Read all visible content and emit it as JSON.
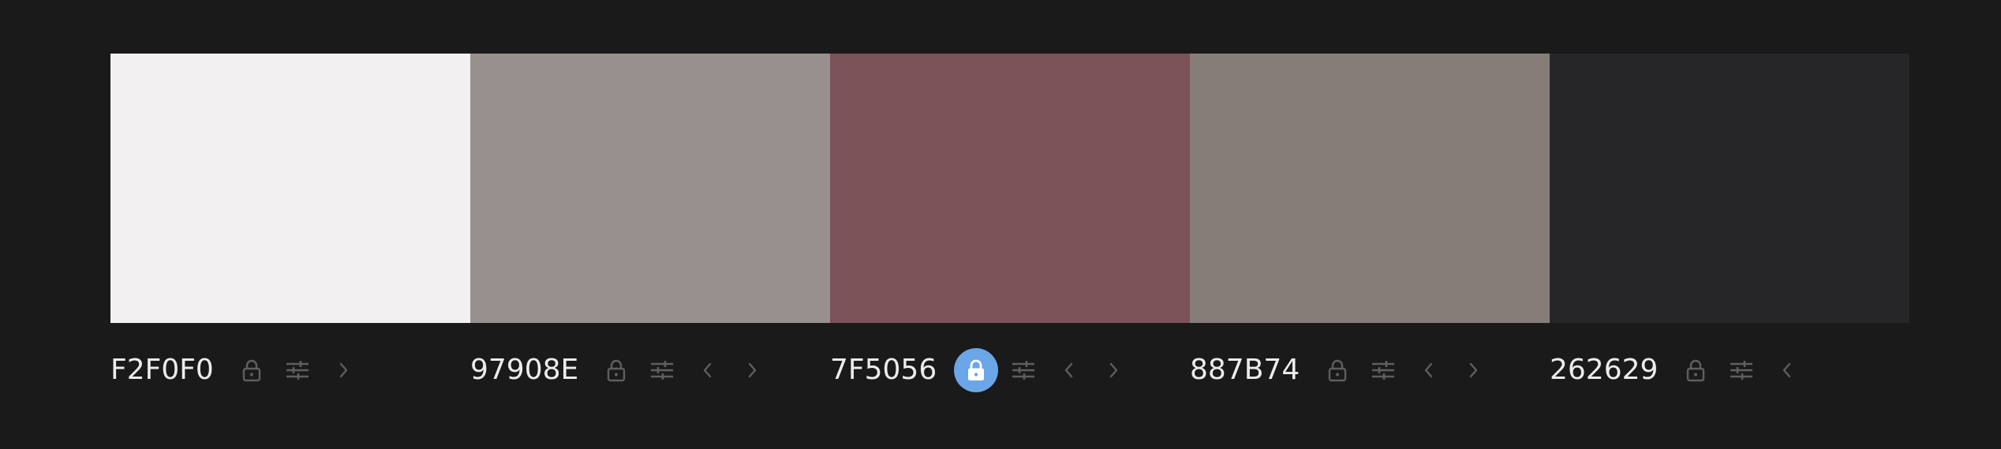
{
  "colors": {
    "background": "#1a1a1b",
    "icon": "#5f5f61",
    "text": "#ececec",
    "lock_active_bg": "#6aa6e8",
    "lock_active_fg": "#ffffff"
  },
  "swatches": [
    {
      "hex": "F2F0F0",
      "color": "#F2F0F0",
      "locked": false,
      "icons": [
        "lock-icon",
        "adjust-sliders-icon",
        "chevron-right-icon"
      ]
    },
    {
      "hex": "97908E",
      "color": "#97908E",
      "locked": false,
      "icons": [
        "lock-icon",
        "adjust-sliders-icon",
        "chevron-left-icon",
        "chevron-right-icon"
      ]
    },
    {
      "hex": "7F5056",
      "color": "#7B5258",
      "locked": true,
      "icons": [
        "lock-icon",
        "adjust-sliders-icon",
        "chevron-left-icon",
        "chevron-right-icon"
      ]
    },
    {
      "hex": "887B74",
      "color": "#877D78",
      "locked": false,
      "icons": [
        "lock-icon",
        "adjust-sliders-icon",
        "chevron-left-icon",
        "chevron-right-icon"
      ]
    },
    {
      "hex": "262629",
      "color": "#262629",
      "locked": false,
      "icons": [
        "lock-icon",
        "adjust-sliders-icon",
        "chevron-left-icon"
      ]
    }
  ]
}
